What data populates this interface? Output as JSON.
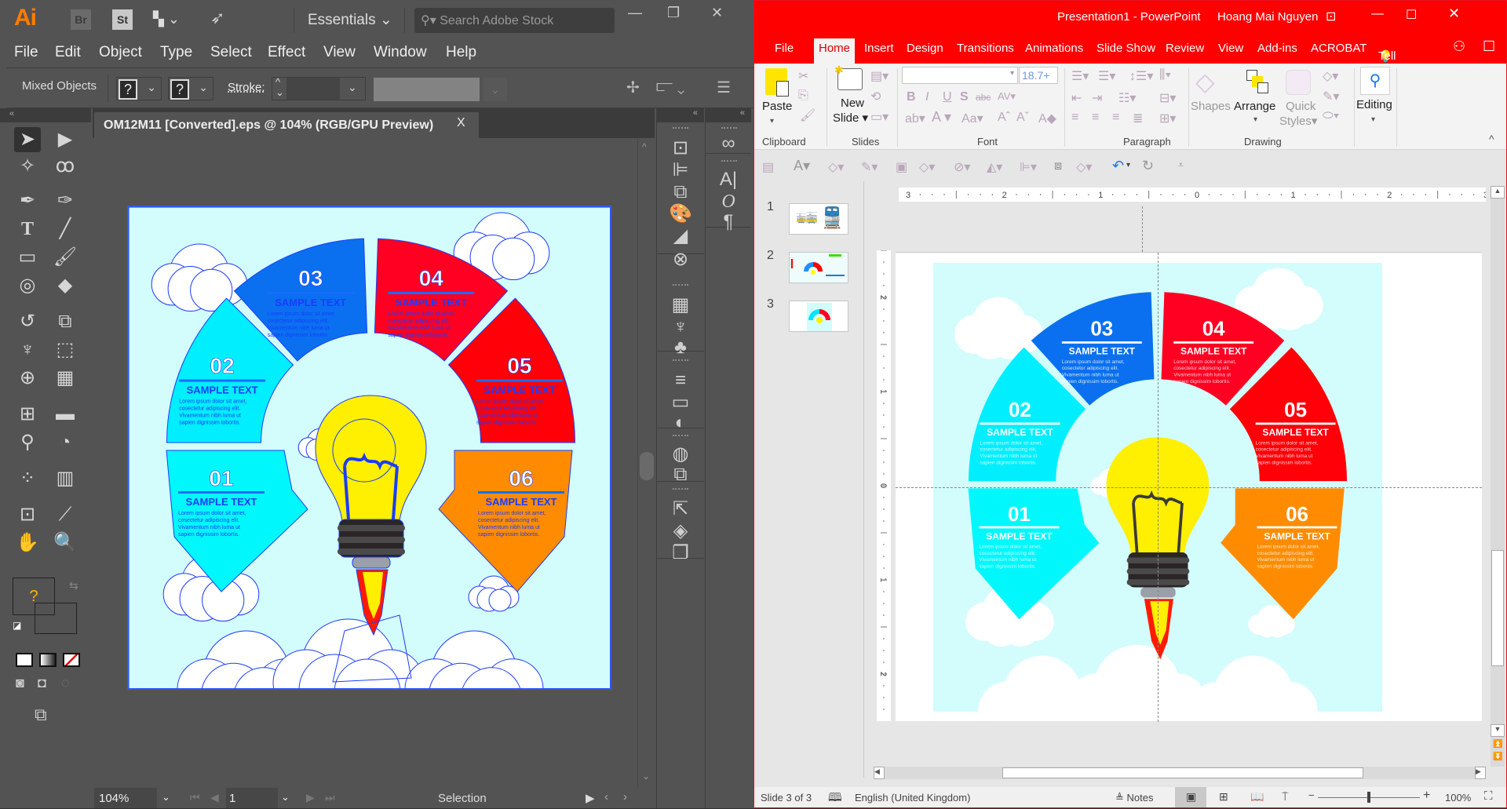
{
  "illustrator": {
    "app_logo": "Ai",
    "bridge_label": "Br",
    "stock_label": "St",
    "workspace": "Essentials",
    "search_placeholder": "Search Adobe Stock",
    "menu": [
      "File",
      "Edit",
      "Object",
      "Type",
      "Select",
      "Effect",
      "View",
      "Window",
      "Help"
    ],
    "options_bar": {
      "selection_type": "Mixed Objects",
      "fill_value": "?",
      "stroke_swatch_value": "?",
      "stroke_label": "Stroke:"
    },
    "document_tab": {
      "title": "OM12M11 [Converted].eps @ 104% (RGB/GPU Preview)",
      "close": "X"
    },
    "status_bar": {
      "zoom": "104%",
      "artboard_number": "1",
      "tool_readout": "Selection"
    },
    "color_swatch_unknown": "?",
    "tools": [
      "selection-tool",
      "direct-selection-tool",
      "magic-wand-tool",
      "lasso-tool",
      "pen-tool",
      "curvature-tool",
      "type-tool",
      "line-tool",
      "rectangle-tool",
      "paintbrush-tool",
      "shaper-tool",
      "eraser-tool",
      "rotate-tool",
      "scale-tool",
      "warp-tool",
      "free-transform-tool",
      "shape-builder-tool",
      "perspective-grid-tool",
      "mesh-tool",
      "gradient-tool",
      "eyedropper-tool",
      "blend-tool",
      "symbol-sprayer-tool",
      "column-graph-tool",
      "artboard-tool",
      "slice-tool",
      "hand-tool",
      "zoom-tool"
    ]
  },
  "powerpoint": {
    "window_title": "Presentation1  -  PowerPoint",
    "user_name": "Hoang Mai Nguyen",
    "tabs": [
      "File",
      "Home",
      "Insert",
      "Design",
      "Transitions",
      "Animations",
      "Slide Show",
      "Review",
      "View",
      "Add-ins",
      "ACROBAT"
    ],
    "active_tab": "Home",
    "tell_me": "Tell me",
    "ribbon": {
      "paste": "Paste",
      "new_slide_line1": "New",
      "new_slide_line2": "Slide",
      "font_name": "",
      "font_size": "18.7+",
      "shapes": "Shapes",
      "arrange": "Arrange",
      "quick_styles_line1": "Quick",
      "quick_styles_line2": "Styles",
      "editing": "Editing",
      "groups": [
        "Clipboard",
        "Slides",
        "Font",
        "Paragraph",
        "Drawing"
      ]
    },
    "ruler_h": [
      "3",
      "2",
      "1",
      "0",
      "1",
      "2",
      "3"
    ],
    "ruler_v": [
      "2",
      "1",
      "0",
      "1",
      "2"
    ],
    "slides": [
      {
        "number": "1"
      },
      {
        "number": "2"
      },
      {
        "number": "3",
        "selected": true
      }
    ],
    "status_bar": {
      "slide_info": "Slide 3 of 3",
      "language": "English (United Kingdom)",
      "notes": "Notes",
      "zoom": "100%",
      "zoom_slider_fraction": 0.5
    }
  },
  "infographic": {
    "segments": [
      {
        "number": "01",
        "heading": "SAMPLE TEXT",
        "color": "#00f8fc",
        "body": [
          "Lorem ipsum dolor sit amet,",
          "cosectetur adipiscing elit.",
          "Vivamentum nibh luma ut",
          "sapien dignissim lobortis."
        ]
      },
      {
        "number": "02",
        "heading": "SAMPLE TEXT",
        "color": "#00eefd",
        "body": [
          "Lorem ipsum dolor sit amet,",
          "cosectetur adipiscing elit.",
          "Vivamentum nibh luma ut",
          "sapien dignissim lobortis."
        ]
      },
      {
        "number": "03",
        "heading": "SAMPLE TEXT",
        "color": "#0a70f0",
        "body": [
          "Lorem ipsum dolor sit amet,",
          "cosectetur adipiscing elit.",
          "Vivamentum nibh luma ut",
          "sapien dignissim lobortis."
        ]
      },
      {
        "number": "04",
        "heading": "SAMPLE TEXT",
        "color": "#ff0022",
        "body": [
          "Lorem ipsum dolor sit amet,",
          "cosectetur adipiscing elit.",
          "Vivamentum nibh luma ut",
          "sapien dignissim lobortis."
        ]
      },
      {
        "number": "05",
        "heading": "SAMPLE TEXT",
        "color": "#ff0008",
        "body": [
          "Lorem ipsum dolor sit amet,",
          "cosectetur adipiscing elit.",
          "Vivamentum nibh luma ut",
          "sapien dignissim lobortis."
        ]
      },
      {
        "number": "06",
        "heading": "SAMPLE TEXT",
        "color": "#ff8c00",
        "body": [
          "Lorem ipsum dolor sit amet,",
          "cosectetur adipiscing elit.",
          "Vivamentum nibh luma ut",
          "sapien dignissim lobortis."
        ]
      }
    ],
    "background": "#d3fcfc",
    "bulb_color": "#ffef00"
  }
}
